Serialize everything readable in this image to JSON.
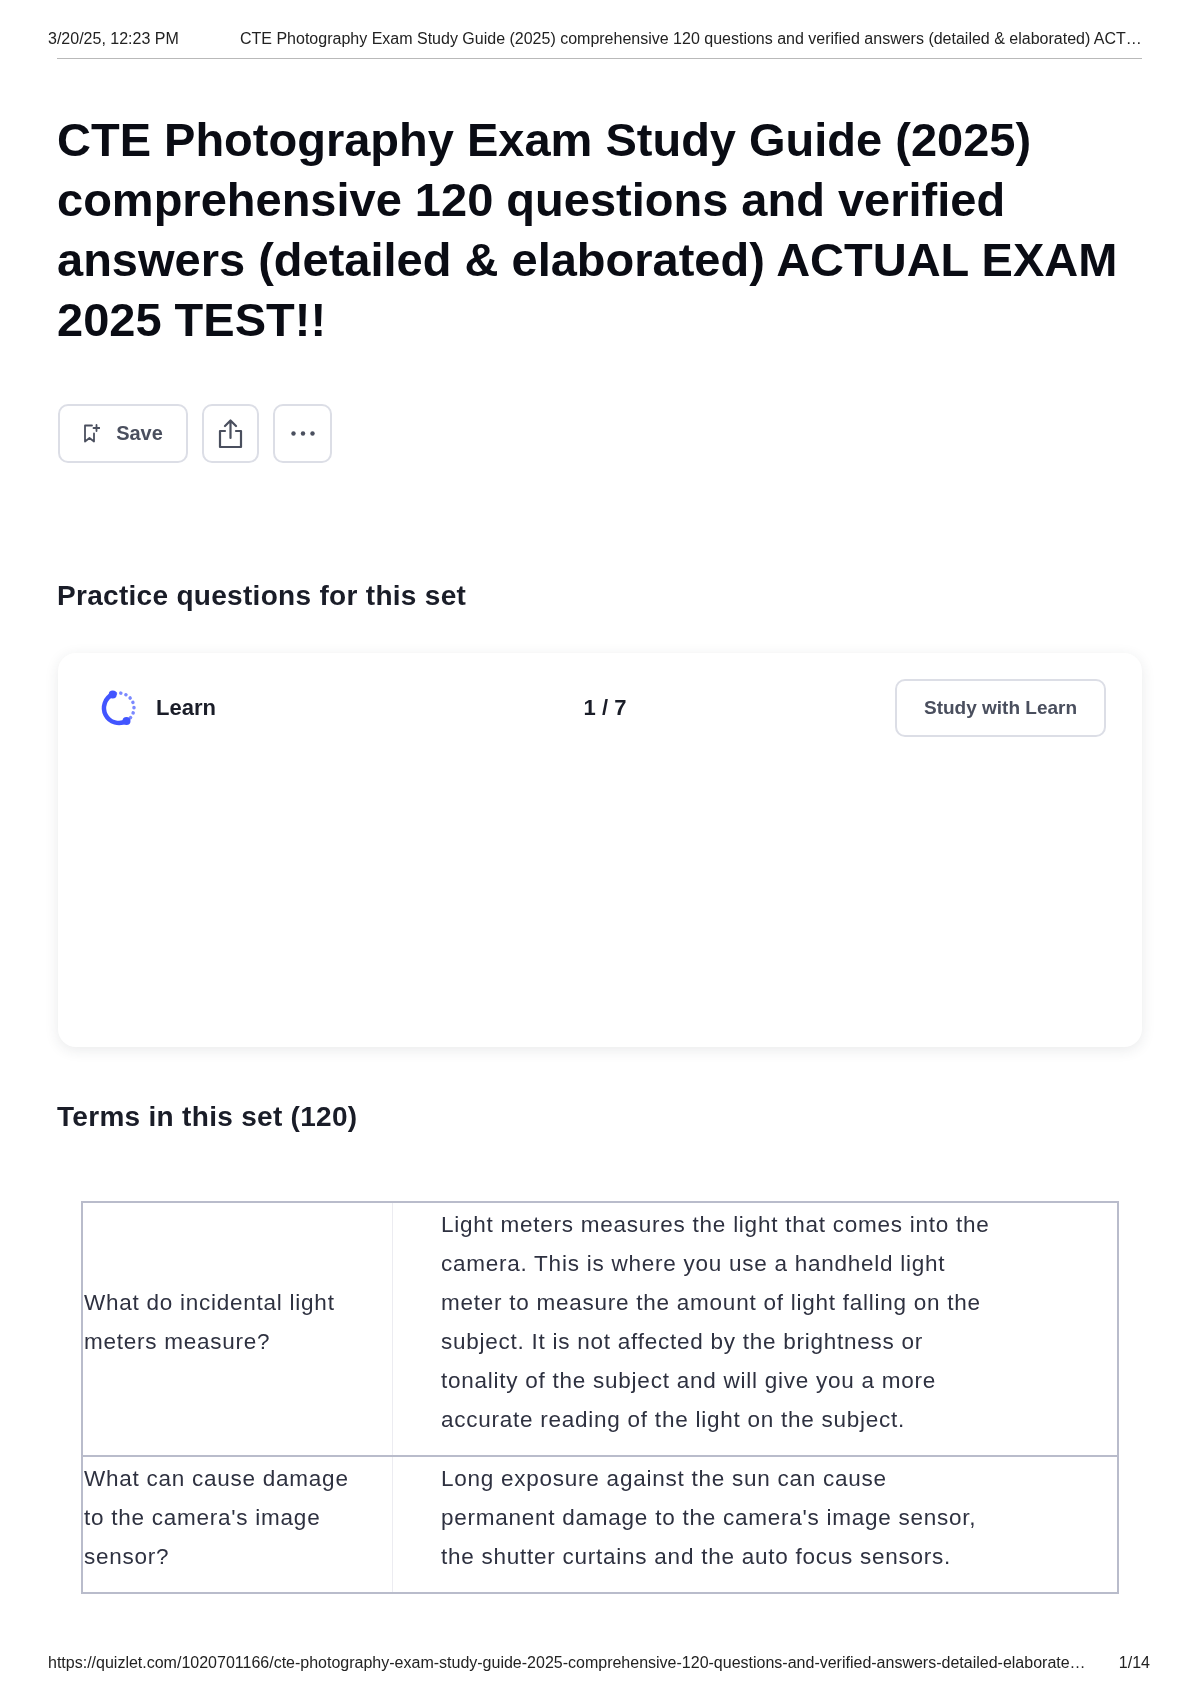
{
  "print_header": {
    "date": "3/20/25, 12:23 PM",
    "title": "CTE Photography Exam Study Guide (2025) comprehensive 120 questions and verified answers (detailed & elaborated) ACT…"
  },
  "set_title": "CTE Photography Exam Study Guide (2025) comprehensive 120 questions and verified answers (detailed & elaborated) ACTUAL EXAM 2025 TEST!!",
  "actions": [
    {
      "kind": "save",
      "label": "Save"
    },
    {
      "kind": "share"
    },
    {
      "kind": "more"
    }
  ],
  "practice": {
    "heading": "Practice questions for this set",
    "mode": "Learn",
    "progress": "1 / 7",
    "button": "Study with Learn"
  },
  "terms": {
    "heading": "Terms in this set (120)",
    "rows": [
      {
        "term": "What do incidental light meters measure?",
        "definition": "Light meters measures the light that comes into the camera. This is where you use a handheld light meter to measure the amount of light falling on the subject. It is not affected by the brightness or tonality of the subject and will give you a more accurate reading of the light on the subject."
      },
      {
        "term": "What can cause damage to the camera's image sensor?",
        "definition": "Long exposure against the sun can cause permanent damage to the camera's image sensor, the shutter curtains and the auto focus sensors."
      }
    ]
  },
  "print_footer": {
    "url": "https://quizlet.com/1020701166/cte-photography-exam-study-guide-2025-comprehensive-120-questions-and-verified-answers-detailed-elaborate…",
    "page": "1/14"
  }
}
